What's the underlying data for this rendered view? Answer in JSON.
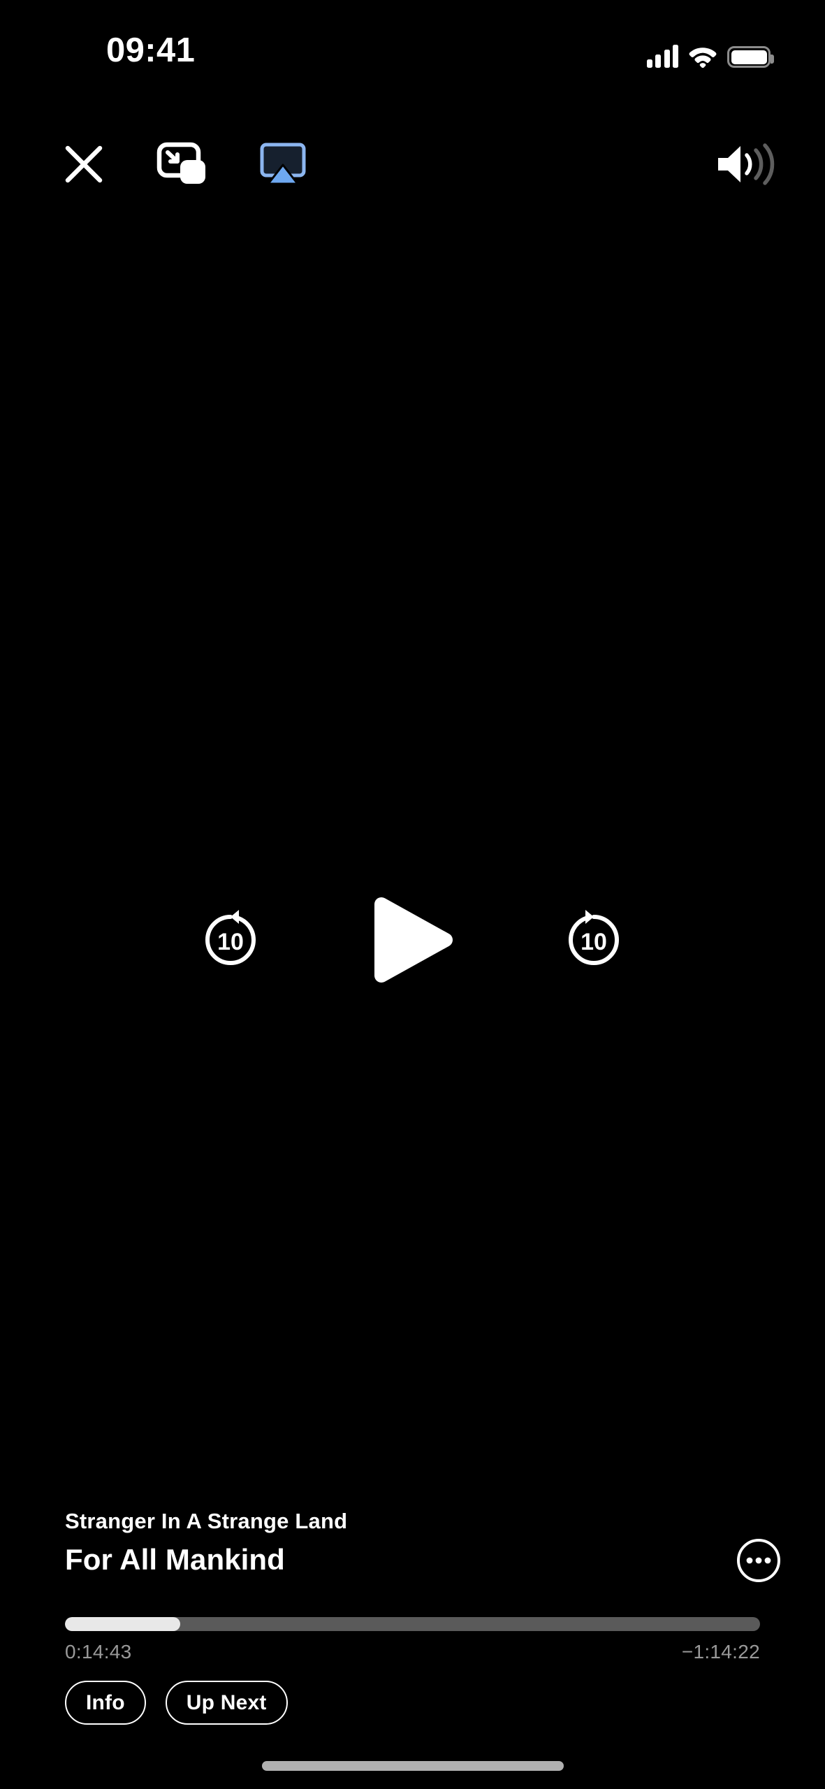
{
  "status_bar": {
    "time": "09:41",
    "cellular_icon": "cellular-signal-icon",
    "cellular_bars": 4,
    "wifi_icon": "wifi-icon",
    "battery_icon": "battery-icon",
    "battery_level": 100
  },
  "top_controls": {
    "close": {
      "label": "Close",
      "icon": "close-icon"
    },
    "pip": {
      "label": "Picture in Picture",
      "icon": "picture-in-picture-icon"
    },
    "airplay": {
      "label": "AirPlay",
      "icon": "airplay-icon",
      "active": true,
      "color": "#8cb6f0"
    },
    "volume": {
      "label": "Volume",
      "icon": "volume-icon",
      "waves_active": 1,
      "waves_total": 3
    }
  },
  "transport": {
    "skip_back": {
      "label": "10",
      "icon": "skip-back-10-icon",
      "seconds": 10
    },
    "play": {
      "label": "Play",
      "icon": "play-icon",
      "state": "paused"
    },
    "skip_forward": {
      "label": "10",
      "icon": "skip-forward-10-icon",
      "seconds": 10
    }
  },
  "now_playing": {
    "episode_title": "Stranger In A Strange Land",
    "show_title": "For All Mankind",
    "more_options": {
      "label": "More",
      "icon": "ellipsis-circle-icon"
    },
    "elapsed_time": "0:14:43",
    "remaining_time": "−1:14:22",
    "progress_percent": 16.6
  },
  "actions": {
    "info": "Info",
    "up_next": "Up Next"
  },
  "home_indicator": "home-indicator",
  "colors": {
    "background": "#000000",
    "text_primary": "#ffffff",
    "text_secondary": "#999999",
    "track_filled": "#e8e8e8",
    "track_remaining": "#5a5a5a",
    "accent_airplay": "#8cb6f0"
  }
}
